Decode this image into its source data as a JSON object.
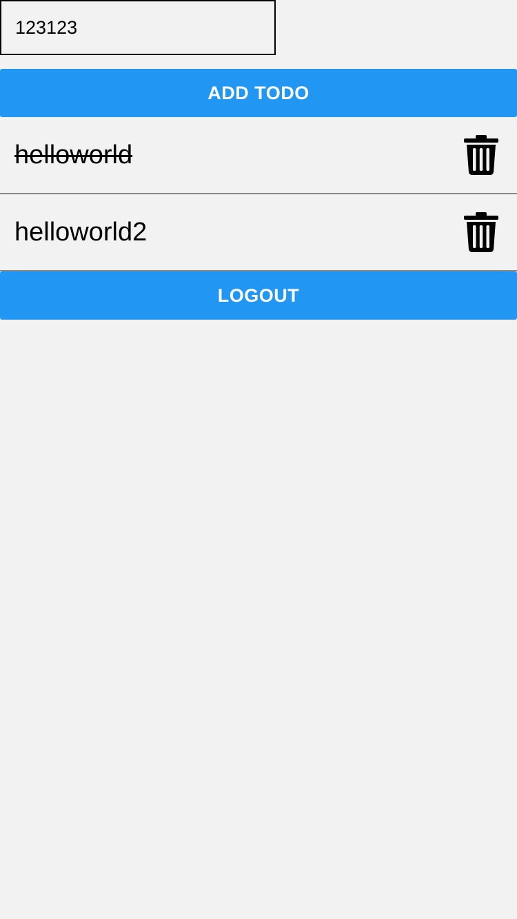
{
  "todo_input": {
    "value": "123123"
  },
  "add_button": {
    "label": "ADD TODO"
  },
  "todos": [
    {
      "text": "helloworld",
      "completed": true,
      "delete_icon": "trash-icon"
    },
    {
      "text": "helloworld2",
      "completed": false,
      "delete_icon": "trash-icon"
    }
  ],
  "logout_button": {
    "label": "LOGOUT"
  },
  "colors": {
    "accent": "#2196f3",
    "background": "#f2f2f2",
    "divider": "#888888"
  }
}
